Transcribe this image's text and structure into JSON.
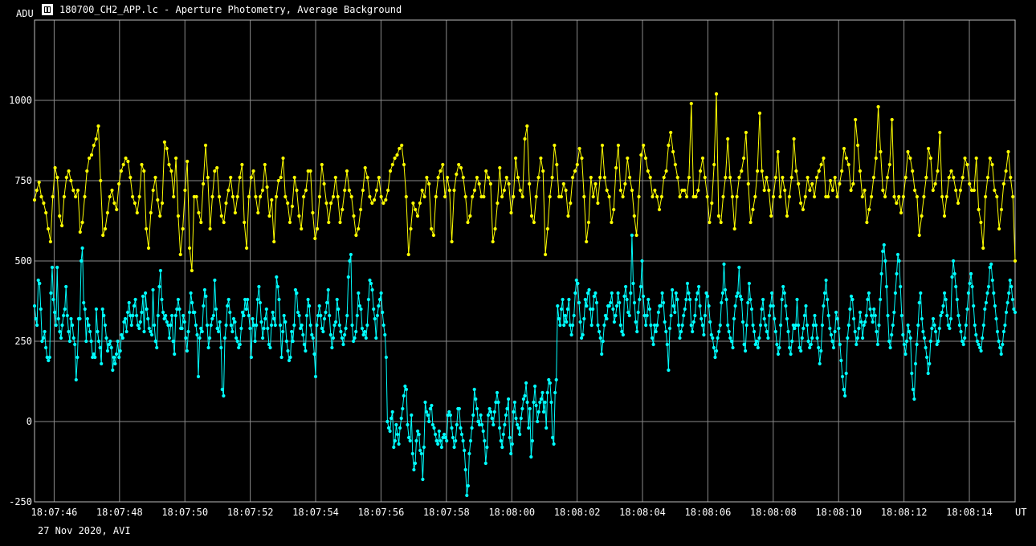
{
  "window": {
    "title": "180700_CH2_APP.lc - Aperture Photometry, Average Background",
    "footer": "27 Nov 2020, AVI",
    "icon": "lightcurve-app-icon"
  },
  "chart_data": {
    "type": "line",
    "ylabel": "ADU",
    "xlabel": "UT",
    "ylim": [
      -250,
      1250
    ],
    "yticks": [
      -250,
      0,
      250,
      500,
      750,
      1000
    ],
    "xlim": [
      "18:07:45.4",
      "18:08:15.4"
    ],
    "xticks": [
      "18:07:46",
      "18:07:48",
      "18:07:50",
      "18:07:52",
      "18:07:54",
      "18:07:56",
      "18:07:58",
      "18:08:00",
      "18:08:02",
      "18:08:04",
      "18:08:06",
      "18:08:08",
      "18:08:10",
      "18:08:12",
      "18:08:14"
    ],
    "grid": true,
    "markers": true,
    "series": [
      {
        "color": "#ffff00",
        "x_start": "18:07:45.4",
        "x_end": "18:08:15.4",
        "values": [
          690,
          720,
          745,
          700,
          680,
          650,
          600,
          560,
          700,
          790,
          760,
          640,
          610,
          700,
          760,
          780,
          750,
          720,
          700,
          720,
          590,
          620,
          700,
          780,
          820,
          830,
          860,
          880,
          920,
          750,
          580,
          600,
          650,
          700,
          720,
          680,
          660,
          740,
          780,
          800,
          820,
          810,
          760,
          700,
          680,
          650,
          700,
          800,
          780,
          600,
          540,
          650,
          720,
          760,
          690,
          640,
          680,
          870,
          850,
          800,
          780,
          700,
          820,
          640,
          520,
          600,
          720,
          810,
          540,
          470,
          700,
          700,
          650,
          620,
          740,
          860,
          760,
          600,
          700,
          780,
          790,
          700,
          640,
          620,
          680,
          720,
          760,
          700,
          650,
          700,
          760,
          800,
          620,
          540,
          700,
          760,
          780,
          700,
          650,
          700,
          720,
          800,
          730,
          640,
          690,
          560,
          700,
          750,
          760,
          820,
          700,
          680,
          620,
          670,
          760,
          720,
          640,
          600,
          700,
          720,
          780,
          780,
          650,
          570,
          600,
          700,
          800,
          740,
          680,
          620,
          680,
          700,
          760,
          700,
          620,
          660,
          720,
          780,
          720,
          700,
          640,
          580,
          600,
          660,
          720,
          790,
          760,
          700,
          680,
          690,
          720,
          760,
          700,
          680,
          690,
          720,
          780,
          800,
          820,
          830,
          850,
          860,
          800,
          700,
          520,
          600,
          680,
          660,
          640,
          680,
          720,
          700,
          760,
          740,
          600,
          580,
          700,
          760,
          780,
          800,
          700,
          760,
          720,
          560,
          720,
          770,
          800,
          790,
          760,
          700,
          620,
          640,
          700,
          720,
          760,
          740,
          700,
          700,
          780,
          760,
          740,
          560,
          600,
          680,
          790,
          700,
          720,
          760,
          740,
          650,
          700,
          820,
          760,
          720,
          700,
          880,
          920,
          740,
          640,
          620,
          700,
          760,
          820,
          780,
          520,
          600,
          700,
          760,
          860,
          800,
          700,
          700,
          740,
          720,
          640,
          680,
          760,
          780,
          800,
          850,
          820,
          700,
          560,
          620,
          760,
          700,
          740,
          680,
          760,
          860,
          760,
          720,
          700,
          620,
          660,
          790,
          860,
          720,
          700,
          740,
          820,
          760,
          720,
          640,
          580,
          700,
          830,
          860,
          820,
          780,
          760,
          700,
          720,
          700,
          660,
          700,
          760,
          780,
          860,
          900,
          840,
          800,
          760,
          700,
          720,
          720,
          700,
          760,
          990,
          700,
          700,
          720,
          780,
          820,
          760,
          700,
          620,
          680,
          800,
          1020,
          640,
          620,
          700,
          760,
          880,
          760,
          700,
          600,
          700,
          760,
          780,
          820,
          900,
          740,
          620,
          660,
          700,
          780,
          960,
          780,
          720,
          760,
          720,
          640,
          700,
          760,
          840,
          700,
          760,
          720,
          640,
          700,
          760,
          880,
          780,
          740,
          680,
          660,
          700,
          760,
          720,
          740,
          700,
          760,
          780,
          800,
          820,
          700,
          700,
          750,
          720,
          760,
          700,
          740,
          780,
          850,
          820,
          800,
          720,
          740,
          940,
          860,
          780,
          700,
          720,
          620,
          660,
          700,
          760,
          820,
          980,
          840,
          720,
          700,
          760,
          800,
          940,
          700,
          680,
          700,
          650,
          700,
          760,
          840,
          820,
          780,
          720,
          700,
          580,
          640,
          700,
          760,
          850,
          820,
          720,
          740,
          780,
          900,
          700,
          640,
          700,
          760,
          780,
          760,
          720,
          680,
          720,
          760,
          820,
          800,
          740,
          720,
          720,
          820,
          660,
          620,
          540,
          700,
          760,
          820,
          800,
          720,
          700,
          600,
          660,
          740,
          780,
          840,
          760,
          700,
          500
        ]
      },
      {
        "color": "#00ffff",
        "x_start": "18:07:45.4",
        "x_end": "18:08:15.4",
        "values": [
          360,
          320,
          300,
          440,
          430,
          350,
          250,
          260,
          280,
          230,
          200,
          190,
          200,
          400,
          480,
          380,
          340,
          300,
          480,
          320,
          280,
          260,
          300,
          330,
          350,
          420,
          330,
          280,
          250,
          320,
          300,
          260,
          240,
          130,
          200,
          320,
          320,
          500,
          540,
          370,
          350,
          250,
          320,
          300,
          280,
          250,
          200,
          210,
          200,
          350,
          280,
          250,
          230,
          180,
          350,
          330,
          300,
          260,
          220,
          240,
          250,
          230,
          160,
          200,
          180,
          210,
          250,
          200,
          220,
          270,
          260,
          310,
          320,
          280,
          340,
          370,
          330,
          300,
          330,
          360,
          380,
          330,
          300,
          290,
          310,
          340,
          390,
          280,
          400,
          350,
          320,
          290,
          280,
          270,
          410,
          300,
          250,
          230,
          330,
          420,
          470,
          380,
          340,
          320,
          330,
          310,
          300,
          260,
          300,
          330,
          250,
          210,
          330,
          350,
          380,
          350,
          290,
          290,
          330,
          310,
          260,
          220,
          280,
          340,
          400,
          370,
          340,
          340,
          300,
          270,
          140,
          260,
          290,
          280,
          360,
          410,
          390,
          300,
          230,
          260,
          300,
          320,
          330,
          440,
          350,
          290,
          280,
          310,
          230,
          100,
          80,
          260,
          300,
          360,
          380,
          340,
          300,
          280,
          320,
          310,
          260,
          250,
          230,
          240,
          290,
          340,
          330,
          380,
          350,
          380,
          330,
          290,
          200,
          320,
          300,
          250,
          300,
          380,
          420,
          370,
          310,
          260,
          290,
          320,
          350,
          290,
          240,
          230,
          300,
          340,
          320,
          300,
          450,
          420,
          380,
          300,
          200,
          280,
          330,
          310,
          250,
          220,
          190,
          200,
          280,
          250,
          300,
          410,
          400,
          340,
          330,
          290,
          300,
          270,
          240,
          220,
          330,
          380,
          360,
          300,
          270,
          260,
          210,
          140,
          300,
          330,
          360,
          330,
          290,
          280,
          320,
          340,
          370,
          410,
          330,
          270,
          230,
          260,
          300,
          310,
          380,
          350,
          300,
          280,
          260,
          240,
          270,
          290,
          330,
          450,
          500,
          520,
          300,
          250,
          260,
          280,
          330,
          400,
          360,
          350,
          290,
          270,
          280,
          260,
          300,
          380,
          440,
          430,
          410,
          350,
          320,
          260,
          330,
          360,
          380,
          400,
          340,
          300,
          270,
          200,
          0,
          -20,
          -30,
          10,
          30,
          -80,
          -60,
          -10,
          -40,
          -70,
          -20,
          10,
          40,
          80,
          110,
          100,
          -10,
          -50,
          -60,
          20,
          -100,
          -150,
          -130,
          -60,
          -30,
          -40,
          -90,
          -100,
          -180,
          -80,
          60,
          30,
          20,
          0,
          40,
          50,
          -10,
          -20,
          -40,
          -60,
          -70,
          -30,
          -60,
          -80,
          -50,
          -40,
          -50,
          -60,
          20,
          30,
          20,
          -20,
          -50,
          -80,
          -60,
          -10,
          40,
          40,
          -20,
          -40,
          -60,
          -90,
          -150,
          -230,
          -200,
          -100,
          -60,
          -20,
          20,
          100,
          70,
          40,
          0,
          -10,
          20,
          -10,
          -30,
          -60,
          -130,
          -80,
          20,
          40,
          30,
          10,
          -10,
          30,
          60,
          90,
          60,
          -20,
          -60,
          -80,
          -40,
          -10,
          20,
          40,
          70,
          -50,
          -100,
          -70,
          30,
          60,
          10,
          -10,
          -20,
          -40,
          10,
          40,
          70,
          80,
          120,
          60,
          -20,
          40,
          -110,
          -60,
          60,
          110,
          50,
          0,
          30,
          60,
          70,
          90,
          30,
          60,
          -20,
          90,
          130,
          120,
          60,
          -50,
          -70,
          90,
          130,
          360,
          320,
          300,
          350,
          380,
          300,
          330,
          310,
          350,
          380,
          300,
          270,
          300,
          330,
          400,
          440,
          430,
          370,
          310,
          260,
          270,
          320,
          380,
          360,
          400,
          410,
          350,
          300,
          350,
          390,
          400,
          370,
          300,
          280,
          260,
          210,
          250,
          300,
          330,
          320,
          360,
          360,
          370,
          400,
          350,
          310,
          330,
          360,
          400,
          370,
          300,
          280,
          270,
          390,
          420,
          380,
          340,
          330,
          400,
          580,
          430,
          370,
          310,
          280,
          340,
          380,
          420,
          500,
          390,
          330,
          300,
          330,
          380,
          350,
          300,
          260,
          240,
          300,
          280,
          300,
          340,
          360,
          360,
          400,
          370,
          310,
          280,
          240,
          160,
          290,
          330,
          410,
          360,
          340,
          400,
          380,
          300,
          260,
          280,
          300,
          330,
          350,
          380,
          430,
          400,
          380,
          300,
          280,
          310,
          330,
          380,
          400,
          420,
          360,
          320,
          300,
          270,
          330,
          400,
          390,
          360,
          310,
          270,
          260,
          230,
          200,
          220,
          260,
          280,
          300,
          370,
          400,
          490,
          410,
          380,
          300,
          280,
          260,
          250,
          230,
          320,
          360,
          390,
          400,
          480,
          390,
          380,
          310,
          240,
          220,
          300,
          370,
          430,
          380,
          350,
          300,
          280,
          240,
          250,
          230,
          260,
          300,
          350,
          380,
          320,
          300,
          280,
          260,
          330,
          360,
          400,
          360,
          320,
          280,
          240,
          210,
          230,
          300,
          380,
          420,
          400,
          360,
          320,
          280,
          230,
          210,
          250,
          300,
          290,
          300,
          380,
          300,
          230,
          220,
          260,
          290,
          330,
          360,
          300,
          250,
          230,
          240,
          260,
          300,
          330,
          300,
          260,
          230,
          180,
          220,
          300,
          360,
          400,
          440,
          380,
          330,
          290,
          270,
          250,
          230,
          280,
          340,
          320,
          290,
          240,
          190,
          140,
          100,
          80,
          150,
          260,
          300,
          350,
          390,
          380,
          320,
          280,
          240,
          260,
          290,
          340,
          310,
          260,
          300,
          310,
          330,
          380,
          400,
          350,
          330,
          310,
          350,
          330,
          280,
          240,
          300,
          380,
          460,
          530,
          550,
          500,
          420,
          330,
          250,
          230,
          270,
          300,
          340,
          400,
          460,
          520,
          500,
          420,
          330,
          270,
          240,
          210,
          250,
          300,
          280,
          260,
          150,
          100,
          70,
          180,
          240,
          300,
          370,
          400,
          320,
          280,
          260,
          230,
          200,
          150,
          180,
          250,
          290,
          320,
          300,
          280,
          240,
          250,
          290,
          330,
          340,
          360,
          400,
          380,
          330,
          300,
          290,
          320,
          450,
          500,
          460,
          420,
          380,
          330,
          300,
          280,
          250,
          240,
          260,
          300,
          350,
          400,
          430,
          460,
          420,
          360,
          300,
          270,
          250,
          240,
          230,
          220,
          260,
          300,
          350,
          370,
          400,
          420,
          480,
          490,
          440,
          400,
          360,
          320,
          280,
          250,
          230,
          210,
          240,
          280,
          300,
          340,
          370,
          400,
          440,
          420,
          380,
          350,
          340
        ]
      }
    ]
  }
}
